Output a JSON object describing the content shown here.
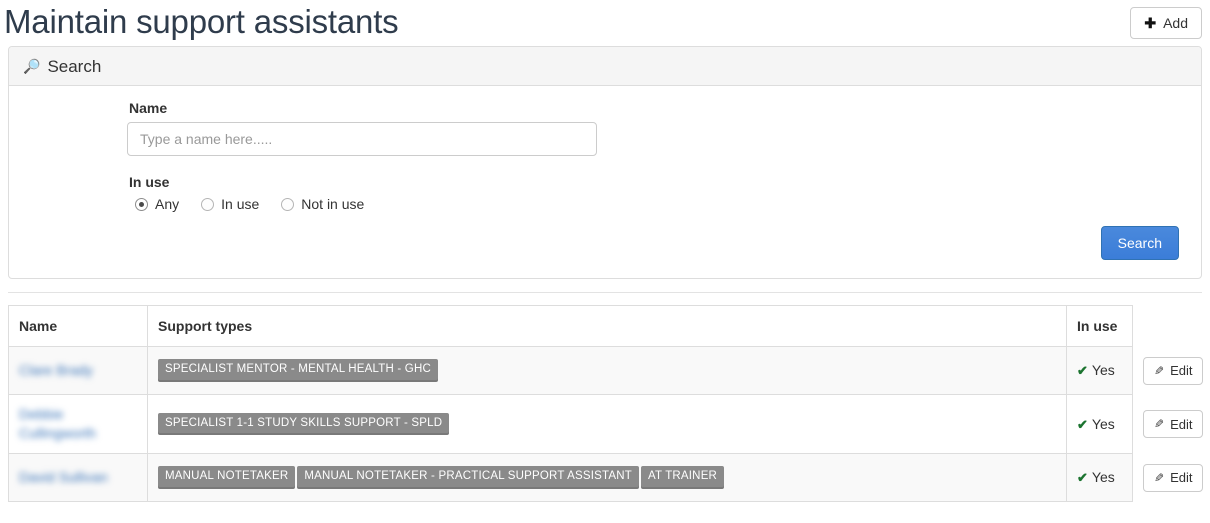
{
  "header": {
    "title": "Maintain support assistants",
    "add_label": "Add",
    "add_icon": "plus-icon"
  },
  "search_panel": {
    "title": "Search",
    "icon": "magnifier-icon",
    "name_label": "Name",
    "name_value": "",
    "name_placeholder": "Type a name here.....",
    "inuse_label": "In use",
    "inuse_options": [
      {
        "label": "Any",
        "selected": true
      },
      {
        "label": "In use",
        "selected": false
      },
      {
        "label": "Not in use",
        "selected": false
      }
    ],
    "search_button": "Search"
  },
  "results_table": {
    "columns": [
      "Name",
      "Support types",
      "In use",
      ""
    ],
    "edit_label": "Edit",
    "edit_icon": "pencil-icon",
    "check_icon": "check-icon",
    "rows": [
      {
        "name": "Clare Brady",
        "name_redacted": true,
        "support_types": [
          "Specialist Mentor - Mental Health - GHC"
        ],
        "in_use": "Yes",
        "edit": "Edit"
      },
      {
        "name": "Debbie Cullingworth",
        "name_redacted": true,
        "support_types": [
          "Specialist 1-1 Study Skills Support - SpLD"
        ],
        "in_use": "Yes",
        "edit": "Edit"
      },
      {
        "name": "David Sullivan",
        "name_redacted": true,
        "support_types": [
          "Manual Notetaker",
          "Manual Notetaker - Practical Support Assistant",
          "AT Trainer"
        ],
        "in_use": "Yes",
        "edit": "Edit"
      }
    ]
  },
  "colors": {
    "link": "#3a74b8",
    "primary_button": "#3b7dd8",
    "tag_background": "#8a8a8a",
    "check_green": "#1c7430",
    "panel_heading": "#f5f5f5",
    "border": "#dddddd"
  }
}
